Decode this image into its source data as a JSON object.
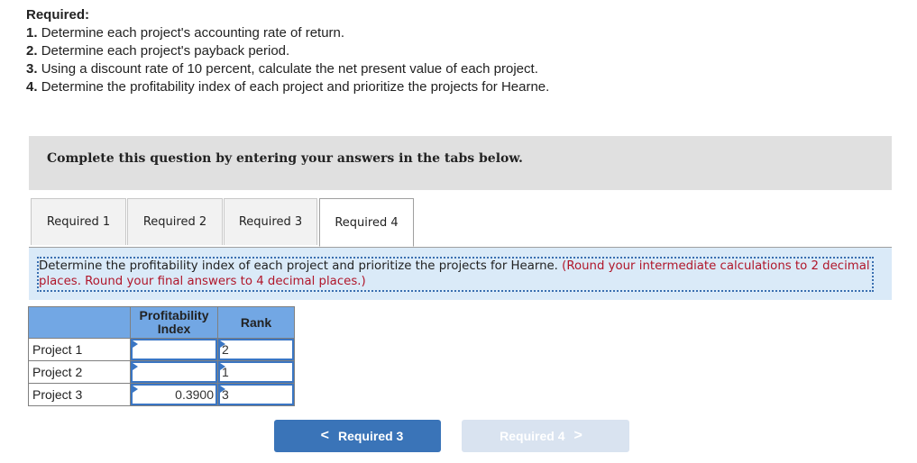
{
  "requirements": {
    "title": "Required:",
    "items": [
      {
        "num": "1.",
        "text": "Determine each project's accounting rate of return."
      },
      {
        "num": "2.",
        "text": "Determine each project's payback period."
      },
      {
        "num": "3.",
        "text": "Using a discount rate of 10 percent, calculate the net present value of each project."
      },
      {
        "num": "4.",
        "text": "Determine the profitability index of each project and prioritize the projects for Hearne."
      }
    ]
  },
  "instruction_bar": "Complete this question by entering your answers in the tabs below.",
  "tabs": [
    {
      "label": "Required 1",
      "active": false
    },
    {
      "label": "Required 2",
      "active": false
    },
    {
      "label": "Required 3",
      "active": false
    },
    {
      "label": "Required 4",
      "active": true
    }
  ],
  "prompt": {
    "main": "Determine the profitability index of each project and prioritize the projects for Hearne. ",
    "note": "(Round your intermediate calculations to 2 decimal places. Round your final answers to 4 decimal places.)"
  },
  "table": {
    "headers": [
      "",
      "Profitability Index",
      "Rank"
    ],
    "rows": [
      {
        "label": "Project 1",
        "profitability_index": "",
        "rank": "2"
      },
      {
        "label": "Project 2",
        "profitability_index": "",
        "rank": "1"
      },
      {
        "label": "Project 3",
        "profitability_index": "0.3900",
        "rank": "3"
      }
    ]
  },
  "navigation": {
    "prev": {
      "label": "Required 3",
      "icon": "chevron-left-icon",
      "glyph": "<"
    },
    "next": {
      "label": "Required 4",
      "icon": "chevron-right-icon",
      "glyph": ">",
      "disabled": true
    }
  }
}
